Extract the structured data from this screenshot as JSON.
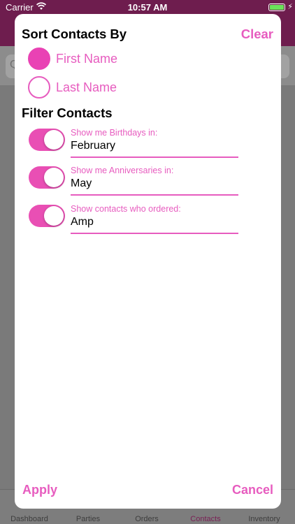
{
  "status_bar": {
    "carrier": "Carrier",
    "time": "10:57 AM"
  },
  "search": {
    "glyph": "Q"
  },
  "tab_bar": {
    "items": [
      {
        "label": "Dashboard"
      },
      {
        "label": "Parties"
      },
      {
        "label": "Orders"
      },
      {
        "label": "Contacts"
      },
      {
        "label": "Inventory"
      }
    ]
  },
  "modal": {
    "sort_title": "Sort Contacts By",
    "clear_label": "Clear",
    "sort_options": [
      {
        "label": "First Name",
        "selected": true
      },
      {
        "label": "Last Name",
        "selected": false
      }
    ],
    "filter_title": "Filter Contacts",
    "filters": [
      {
        "label": "Show me Birthdays in:",
        "value": "February",
        "enabled": true
      },
      {
        "label": "Show me Anniversaries in:",
        "value": "May",
        "enabled": true
      },
      {
        "label": "Show contacts who ordered:",
        "value": "Amp",
        "enabled": true
      }
    ],
    "apply_label": "Apply",
    "cancel_label": "Cancel"
  },
  "colors": {
    "accent": "#e75cbf",
    "header": "#6e1d4e",
    "battery": "#6be25a"
  }
}
